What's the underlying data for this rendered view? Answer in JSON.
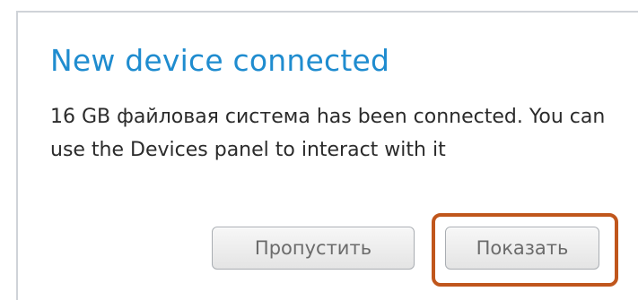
{
  "dialog": {
    "title": "New device connected",
    "message": "16 GB файловая система has been connected. You can use the Devices panel to interact with it",
    "buttons": {
      "skip_label": "Пропустить",
      "show_label": "Показать"
    }
  },
  "colors": {
    "title": "#1f8ccf",
    "highlight": "#c0561c"
  }
}
